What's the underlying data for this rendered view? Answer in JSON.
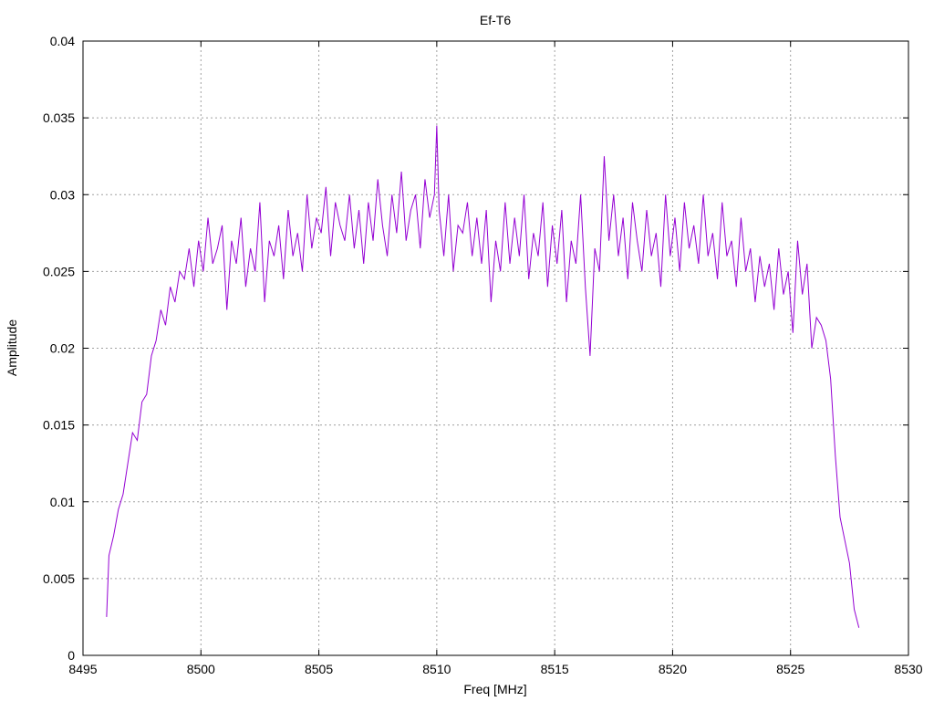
{
  "chart_data": {
    "type": "line",
    "title": "Ef-T6",
    "xlabel": "Freq [MHz]",
    "ylabel": "Amplitude",
    "xlim": [
      8495,
      8530
    ],
    "ylim": [
      0,
      0.04
    ],
    "grid": true,
    "xticks": [
      8495,
      8500,
      8505,
      8510,
      8515,
      8520,
      8525,
      8530
    ],
    "xtick_labels": [
      "8495",
      "8500",
      "8505",
      "8510",
      "8515",
      "8520",
      "8525",
      "8530"
    ],
    "yticks": [
      0,
      0.005,
      0.01,
      0.015,
      0.02,
      0.025,
      0.03,
      0.035,
      0.04
    ],
    "ytick_labels": [
      "0",
      "0.005",
      "0.01",
      "0.015",
      "0.02",
      "0.025",
      "0.03",
      "0.035",
      "0.04"
    ],
    "series": [
      {
        "color": "#9400d3",
        "x": [
          8496.0,
          8496.1,
          8496.3,
          8496.5,
          8496.7,
          8496.9,
          8497.1,
          8497.3,
          8497.5,
          8497.7,
          8497.9,
          8498.1,
          8498.3,
          8498.5,
          8498.7,
          8498.9,
          8499.1,
          8499.3,
          8499.5,
          8499.7,
          8499.9,
          8500.1,
          8500.3,
          8500.5,
          8500.7,
          8500.9,
          8501.1,
          8501.3,
          8501.5,
          8501.7,
          8501.9,
          8502.1,
          8502.3,
          8502.5,
          8502.7,
          8502.9,
          8503.1,
          8503.3,
          8503.5,
          8503.7,
          8503.9,
          8504.1,
          8504.3,
          8504.5,
          8504.7,
          8504.9,
          8505.1,
          8505.3,
          8505.5,
          8505.7,
          8505.9,
          8506.1,
          8506.3,
          8506.5,
          8506.7,
          8506.9,
          8507.1,
          8507.3,
          8507.5,
          8507.7,
          8507.9,
          8508.1,
          8508.3,
          8508.5,
          8508.7,
          8508.9,
          8509.1,
          8509.3,
          8509.5,
          8509.7,
          8509.9,
          8510.0,
          8510.1,
          8510.3,
          8510.5,
          8510.7,
          8510.9,
          8511.1,
          8511.3,
          8511.5,
          8511.7,
          8511.9,
          8512.1,
          8512.3,
          8512.5,
          8512.7,
          8512.9,
          8513.1,
          8513.3,
          8513.5,
          8513.7,
          8513.9,
          8514.1,
          8514.3,
          8514.5,
          8514.7,
          8514.9,
          8515.1,
          8515.3,
          8515.5,
          8515.7,
          8515.9,
          8516.1,
          8516.3,
          8516.5,
          8516.7,
          8516.9,
          8517.1,
          8517.3,
          8517.5,
          8517.7,
          8517.9,
          8518.1,
          8518.3,
          8518.5,
          8518.7,
          8518.9,
          8519.1,
          8519.3,
          8519.5,
          8519.7,
          8519.9,
          8520.1,
          8520.3,
          8520.5,
          8520.7,
          8520.9,
          8521.1,
          8521.3,
          8521.5,
          8521.7,
          8521.9,
          8522.1,
          8522.3,
          8522.5,
          8522.7,
          8522.9,
          8523.1,
          8523.3,
          8523.5,
          8523.7,
          8523.9,
          8524.1,
          8524.3,
          8524.5,
          8524.7,
          8524.9,
          8525.1,
          8525.3,
          8525.5,
          8525.7,
          8525.9,
          8526.1,
          8526.3,
          8526.5,
          8526.7,
          8526.9,
          8527.1,
          8527.3,
          8527.5,
          8527.7,
          8527.9
        ],
        "y": [
          0.0025,
          0.0065,
          0.0078,
          0.0095,
          0.0105,
          0.0125,
          0.0145,
          0.014,
          0.0165,
          0.017,
          0.0195,
          0.0205,
          0.0225,
          0.0215,
          0.024,
          0.023,
          0.025,
          0.0245,
          0.0265,
          0.024,
          0.027,
          0.025,
          0.0285,
          0.0255,
          0.0265,
          0.028,
          0.0225,
          0.027,
          0.0255,
          0.0285,
          0.024,
          0.0265,
          0.025,
          0.0295,
          0.023,
          0.027,
          0.026,
          0.028,
          0.0245,
          0.029,
          0.026,
          0.0275,
          0.025,
          0.03,
          0.0265,
          0.0285,
          0.0275,
          0.0305,
          0.026,
          0.0295,
          0.028,
          0.027,
          0.03,
          0.0265,
          0.029,
          0.0255,
          0.0295,
          0.027,
          0.031,
          0.028,
          0.026,
          0.03,
          0.0275,
          0.0315,
          0.027,
          0.029,
          0.03,
          0.0265,
          0.031,
          0.0285,
          0.03,
          0.0345,
          0.029,
          0.026,
          0.03,
          0.025,
          0.028,
          0.0275,
          0.0295,
          0.026,
          0.0285,
          0.0255,
          0.029,
          0.023,
          0.027,
          0.025,
          0.0295,
          0.0255,
          0.0285,
          0.026,
          0.03,
          0.0245,
          0.0275,
          0.026,
          0.0295,
          0.024,
          0.028,
          0.0255,
          0.029,
          0.023,
          0.027,
          0.0255,
          0.03,
          0.024,
          0.0195,
          0.0265,
          0.025,
          0.0325,
          0.027,
          0.03,
          0.026,
          0.0285,
          0.0245,
          0.0295,
          0.027,
          0.025,
          0.029,
          0.026,
          0.0275,
          0.024,
          0.03,
          0.026,
          0.0285,
          0.025,
          0.0295,
          0.0265,
          0.028,
          0.0255,
          0.03,
          0.026,
          0.0275,
          0.0245,
          0.0295,
          0.026,
          0.027,
          0.024,
          0.0285,
          0.025,
          0.0265,
          0.023,
          0.026,
          0.024,
          0.0255,
          0.0225,
          0.0265,
          0.0235,
          0.025,
          0.021,
          0.027,
          0.0235,
          0.0255,
          0.02,
          0.022,
          0.0215,
          0.0205,
          0.018,
          0.013,
          0.009,
          0.0075,
          0.006,
          0.003,
          0.0018
        ]
      }
    ]
  }
}
